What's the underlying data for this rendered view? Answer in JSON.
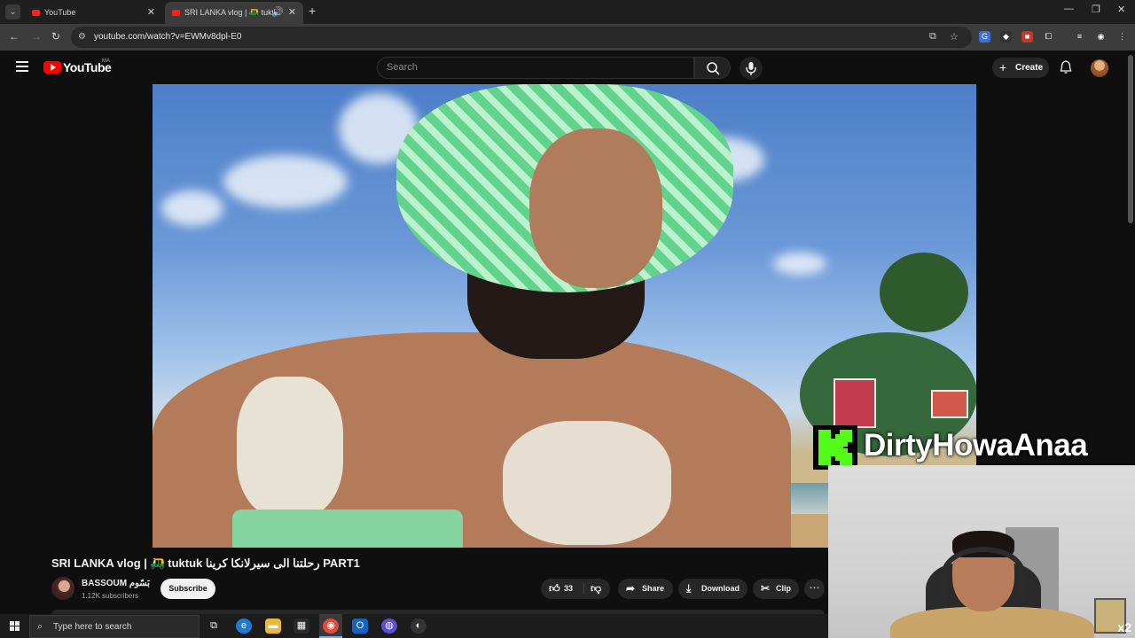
{
  "browser": {
    "tabs": [
      {
        "title": "YouTube"
      },
      {
        "title": "SRI LANKA vlog | 🛺 tuktuk"
      }
    ],
    "url": "youtube.com/watch?v=EWMv8dpl-E0"
  },
  "youtube": {
    "logo_text": "YouTube",
    "country_code": "MA",
    "search_placeholder": "Search",
    "create_label": "Create"
  },
  "video": {
    "title": "SRI LANKA vlog | 🛺 tuktuk رحلتنا الى سيرلانكا كرينا PART1",
    "channel_name": "BASSOUM بَسّوم",
    "subscribers": "1.12K subscribers",
    "subscribe_label": "Subscribe",
    "likes": "33",
    "share_label": "Share",
    "download_label": "Download",
    "clip_label": "Clip"
  },
  "overlay": {
    "kick_letter": "K",
    "streamer_name": "DirtyHowaAnaa",
    "badge": "x2"
  },
  "taskbar": {
    "search_placeholder": "Type here to search"
  }
}
